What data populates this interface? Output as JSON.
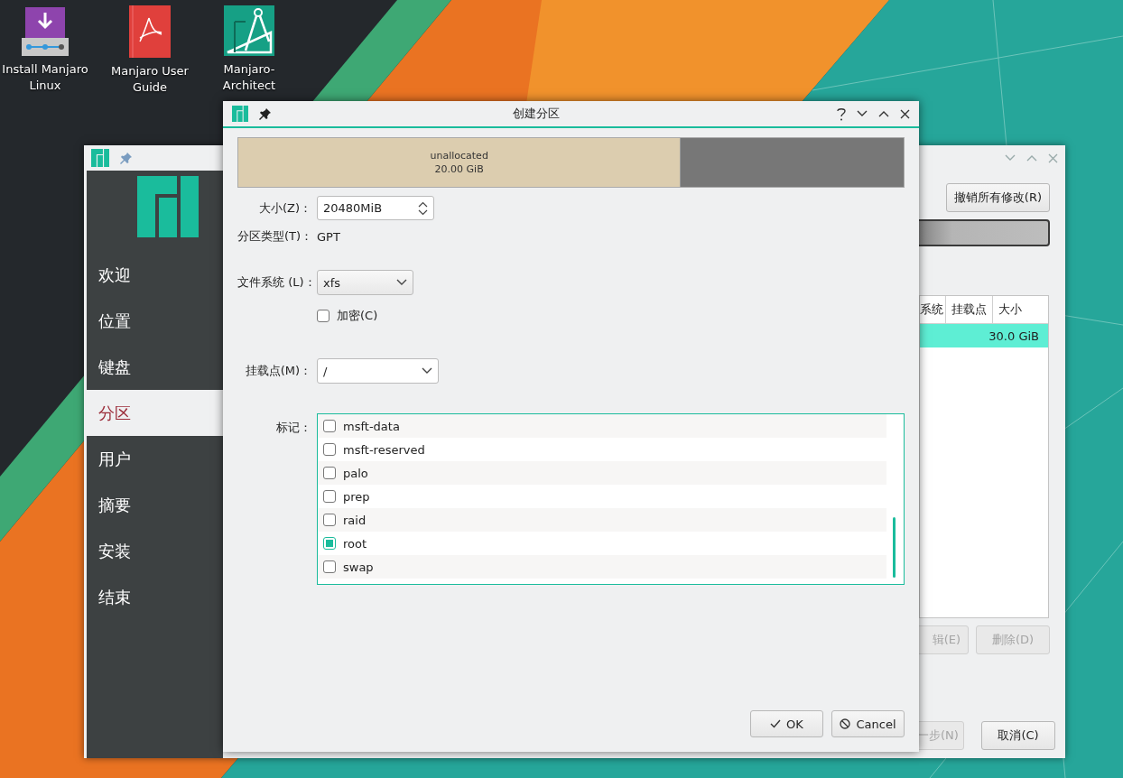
{
  "desktop_icons": [
    {
      "label": "Install Manjaro Linux",
      "kind": "installer"
    },
    {
      "label": "Manjaro User Guide",
      "kind": "guide"
    },
    {
      "label": "Manjaro-Architect",
      "kind": "architect"
    }
  ],
  "app_window": {
    "sidebar": [
      {
        "label": "欢迎",
        "selected": false
      },
      {
        "label": "位置",
        "selected": false
      },
      {
        "label": "键盘",
        "selected": false
      },
      {
        "label": "分区",
        "selected": true
      },
      {
        "label": "用户",
        "selected": false
      },
      {
        "label": "摘要",
        "selected": false
      },
      {
        "label": "安装",
        "selected": false
      },
      {
        "label": "结束",
        "selected": false
      }
    ],
    "revert_button": "撤销所有修改(R)",
    "table": {
      "columns": [
        "系统",
        "挂载点",
        "大小"
      ],
      "rows": [
        {
          "size": "30.0 GiB",
          "selected": true
        }
      ]
    },
    "edit_button": {
      "label": "辑(E)",
      "disabled": true
    },
    "delete_button": {
      "label": "删除(D)",
      "disabled": true
    },
    "next_button": {
      "label": "一步(N)",
      "disabled": true
    },
    "cancel_button": {
      "label": "取消(C)",
      "disabled": false
    }
  },
  "dialog": {
    "title": "创建分区",
    "partition_bar": {
      "label": "unallocated",
      "size": "20.00 GiB",
      "level": 0.664
    },
    "size_label": "大小(Z)：",
    "size_value": "20480MiB",
    "type_label": "分区类型(T)：",
    "type_value": "GPT",
    "filesystem_label": "文件系统 (L)：",
    "filesystem_value": "xfs",
    "encrypt": {
      "label": "加密(C)",
      "checked": false
    },
    "mount_label": "挂载点(M)：",
    "mount_value": "/",
    "flags_label": "标记：",
    "flags": [
      {
        "label": "msft-data",
        "checked": false
      },
      {
        "label": "msft-reserved",
        "checked": false
      },
      {
        "label": "palo",
        "checked": false
      },
      {
        "label": "prep",
        "checked": false
      },
      {
        "label": "raid",
        "checked": false
      },
      {
        "label": "root",
        "checked": true
      },
      {
        "label": "swap",
        "checked": false
      }
    ],
    "ok_button": "OK",
    "cancel_button": "Cancel"
  }
}
